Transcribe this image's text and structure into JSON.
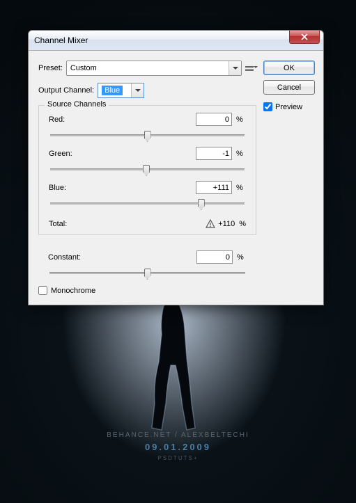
{
  "titlebar": {
    "title": "Channel Mixer"
  },
  "buttons": {
    "ok": "OK",
    "cancel": "Cancel"
  },
  "preview": {
    "label": "Preview",
    "checked": true
  },
  "preset": {
    "label": "Preset:",
    "value": "Custom"
  },
  "output": {
    "label": "Output Channel:",
    "value": "Blue"
  },
  "source": {
    "legend": "Source Channels",
    "channels": [
      {
        "name": "Red:",
        "value": "0",
        "pos": 50
      },
      {
        "name": "Green:",
        "value": "-1",
        "pos": 49.5
      },
      {
        "name": "Blue:",
        "value": "+111",
        "pos": 77.7
      }
    ],
    "total": {
      "label": "Total:",
      "value": "+110",
      "pct": "%"
    }
  },
  "constant": {
    "name": "Constant:",
    "value": "0",
    "pos": 50,
    "pct": "%"
  },
  "mono": {
    "label": "Monochrome",
    "checked": false
  },
  "pct": "%",
  "bg": {
    "line1": "BEHANCE.NET / ALEXBELTECHI",
    "line2": "09.01.2009",
    "line3": "PSDTUTS+"
  }
}
